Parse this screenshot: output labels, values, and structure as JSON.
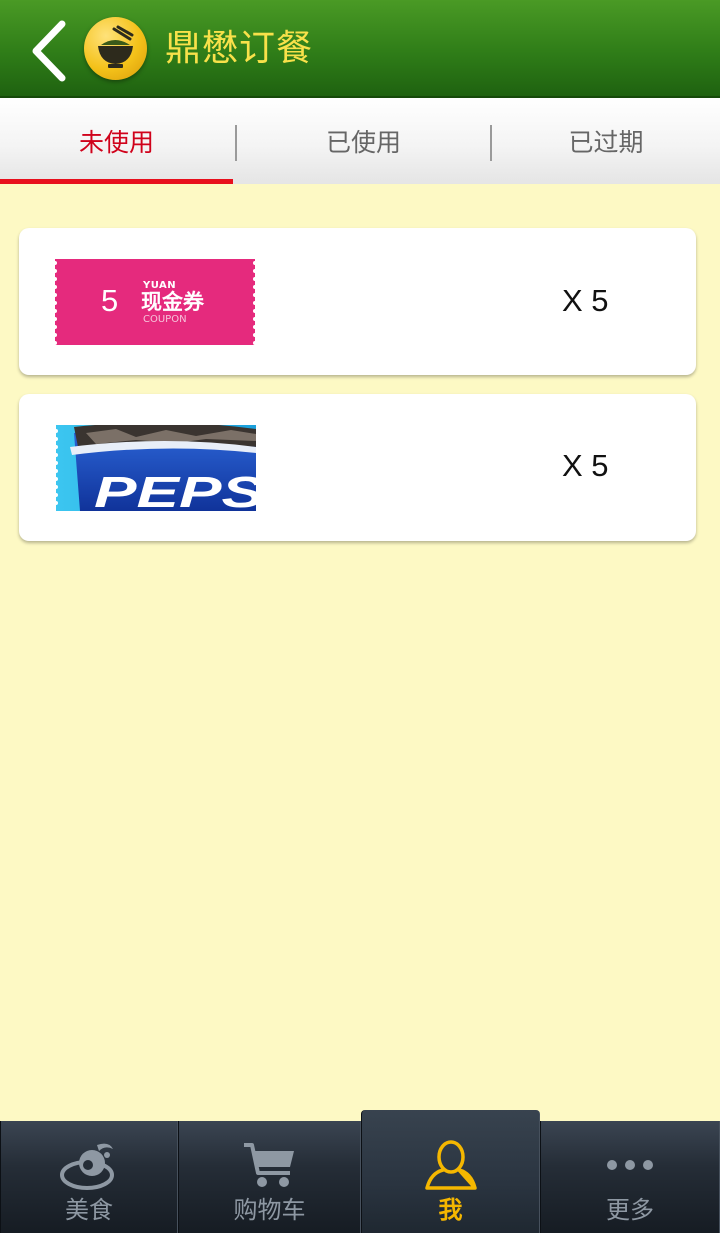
{
  "header": {
    "app_title": "鼎懋订餐"
  },
  "tabs": [
    {
      "label": "未使用",
      "active": true
    },
    {
      "label": "已使用",
      "active": false
    },
    {
      "label": "已过期",
      "active": false
    }
  ],
  "coupons": [
    {
      "type": "cash-coupon",
      "amount": "5",
      "yuan_text": "YUAN",
      "label": "现金券",
      "coupon_text": "COUPON",
      "quantity": "X 5"
    },
    {
      "type": "pepsi-coupon",
      "image_text": "PEPS",
      "quantity": "X 5"
    }
  ],
  "bottom_nav": [
    {
      "label": "美食",
      "icon": "food-icon",
      "active": false
    },
    {
      "label": "购物车",
      "icon": "cart-icon",
      "active": false
    },
    {
      "label": "我",
      "icon": "user-icon",
      "active": true
    },
    {
      "label": "更多",
      "icon": "more-icon",
      "active": false
    }
  ],
  "colors": {
    "header_green": "#2f7d18",
    "title_yellow": "#f8e14a",
    "tab_active_red": "#d0021b",
    "page_bg": "#fdf9c4",
    "coupon_pink": "#e52a7d",
    "nav_active_gold": "#f5b700"
  }
}
